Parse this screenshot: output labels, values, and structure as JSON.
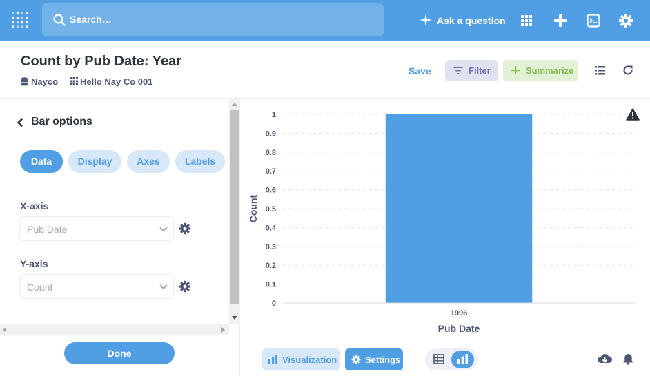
{
  "nav": {
    "search_placeholder": "Search…",
    "ask_label": "Ask a question"
  },
  "question": {
    "title": "Count by Pub Date: Year",
    "database": "Nayco",
    "table": "Hello Nay Co 001"
  },
  "header_actions": {
    "save_label": "Save",
    "filter_label": "Filter",
    "summarize_label": "Summarize"
  },
  "sidebar": {
    "back_label": "Bar options",
    "tabs": [
      "Data",
      "Display",
      "Axes",
      "Labels"
    ],
    "active_tab": "Data",
    "x_axis": {
      "label": "X-axis",
      "value": "Pub Date"
    },
    "y_axis": {
      "label": "Y-axis",
      "value": "Count"
    },
    "done_label": "Done"
  },
  "chart_data": {
    "type": "bar",
    "categories": [
      "1996"
    ],
    "values": [
      1
    ],
    "xlabel": "Pub Date",
    "ylabel": "Count",
    "ylim": [
      0,
      1
    ],
    "yticks": [
      "0",
      "0.1",
      "0.2",
      "0.3",
      "0.4",
      "0.5",
      "0.6",
      "0.7",
      "0.8",
      "0.9",
      "1"
    ],
    "bar_color": "#509ee3",
    "grid": true,
    "warning_icon": "warning-icon"
  },
  "footer": {
    "visualization_label": "Visualization",
    "settings_label": "Settings"
  },
  "colors": {
    "brand": "#509ee3",
    "filter": "#7172ad",
    "summarize": "#84bb4c"
  }
}
